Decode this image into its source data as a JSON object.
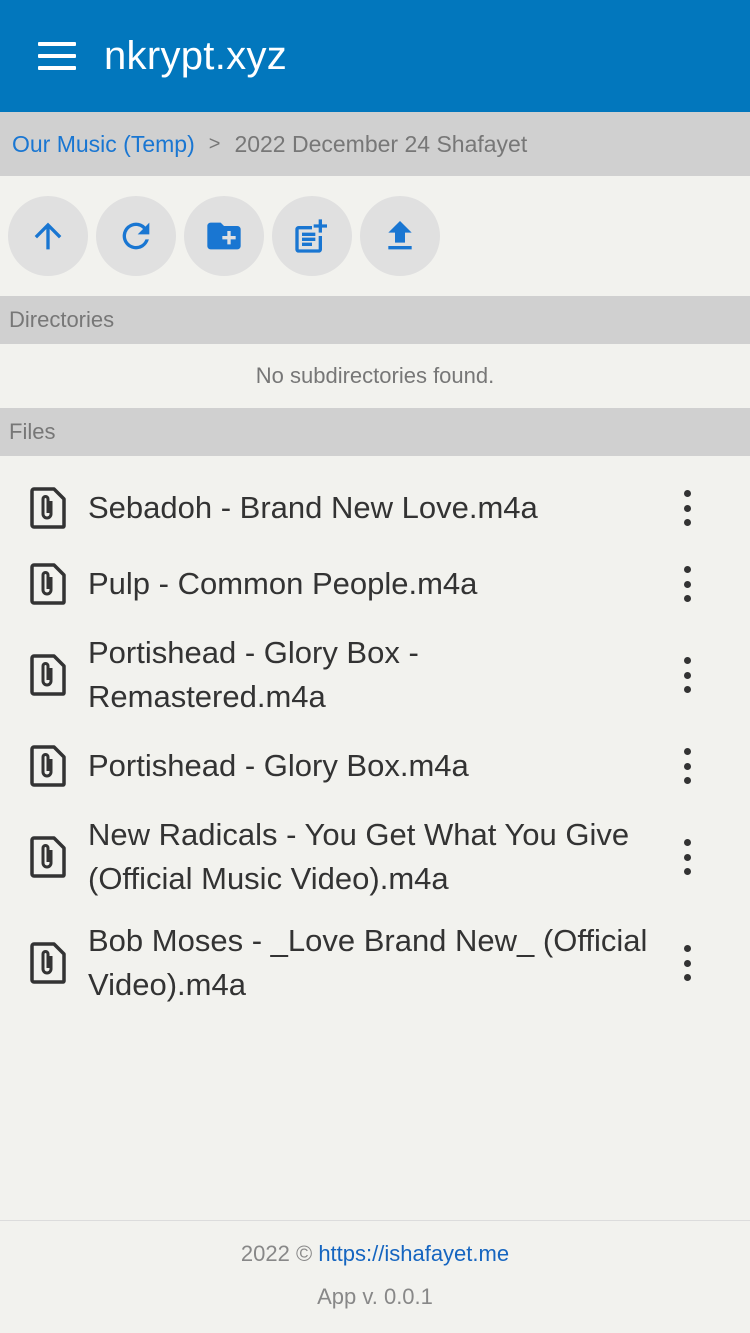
{
  "app": {
    "title": "nkrypt.xyz"
  },
  "breadcrumb": {
    "parent": "Our Music (Temp)",
    "separator": ">",
    "current": "2022 December 24 Shafayet"
  },
  "toolbar": {
    "buttons": [
      {
        "icon": "arrow-up-icon",
        "action": "go-up"
      },
      {
        "icon": "refresh-icon",
        "action": "refresh"
      },
      {
        "icon": "folder-plus-icon",
        "action": "new-folder"
      },
      {
        "icon": "note-plus-icon",
        "action": "new-file"
      },
      {
        "icon": "upload-icon",
        "action": "upload"
      }
    ],
    "accent": "#1976d2"
  },
  "directories": {
    "header": "Directories",
    "empty_message": "No subdirectories found."
  },
  "files": {
    "header": "Files",
    "items": [
      {
        "name": "Sebadoh - Brand New Love.m4a",
        "icon": "paperclip-file-icon"
      },
      {
        "name": "Pulp - Common People.m4a",
        "icon": "paperclip-file-icon"
      },
      {
        "name": "Portishead - Glory Box - Remastered.m4a",
        "icon": "paperclip-file-icon"
      },
      {
        "name": "Portishead - Glory Box.m4a",
        "icon": "paperclip-file-icon"
      },
      {
        "name": "New Radicals - You Get What You Give (Official Music Video).m4a",
        "icon": "paperclip-file-icon"
      },
      {
        "name": "Bob Moses - _Love Brand New_ (Official Video).m4a",
        "icon": "paperclip-file-icon"
      }
    ]
  },
  "footer": {
    "copyright": "2022 ©",
    "link": "https://ishafayet.me",
    "version": "App v. 0.0.1"
  },
  "colors": {
    "header": "#0277bd",
    "background": "#f2f2ee",
    "section": "#d0d0d0",
    "link": "#1976d2"
  }
}
